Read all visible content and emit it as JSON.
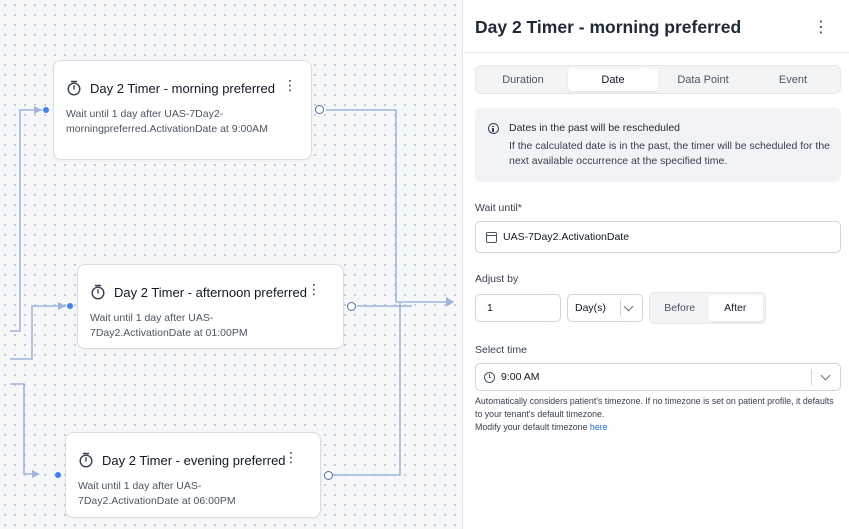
{
  "canvas": {
    "nodes": [
      {
        "title": "Day 2 Timer - morning preferred",
        "description": "Wait until 1 day after UAS-7Day2-morningpreferred.ActivationDate at 9:00AM"
      },
      {
        "title": "Day 2 Timer - afternoon preferred",
        "description": "Wait until 1 day after UAS-7Day2.ActivationDate at 01:00PM"
      },
      {
        "title": "Day 2 Timer - evening preferred",
        "description": "Wait until 1 day after UAS-7Day2.ActivationDate at 06:00PM"
      }
    ],
    "kebab": "⋮"
  },
  "panel": {
    "title": "Day 2 Timer - morning preferred",
    "kebab": "⋮",
    "tabs": [
      "Duration",
      "Date",
      "Data Point",
      "Event"
    ],
    "active_tab": "Date",
    "notice": {
      "title": "Dates in the past will be rescheduled",
      "body": "If the calculated date is in the past, the timer will be scheduled for the next available occurrence at the specified time."
    },
    "wait_until": {
      "label": "Wait until",
      "required_mark": "*",
      "value": "UAS-7Day2.ActivationDate"
    },
    "adjust_by": {
      "label": "Adjust by",
      "amount": "1",
      "unit": "Day(s)",
      "before_label": "Before",
      "after_label": "After",
      "selected": "After"
    },
    "select_time": {
      "label": "Select time",
      "value": "9:00 AM",
      "help": "Automatically considers patient's timezone. If no timezone is set on patient profile, it defaults to your tenant's default timezone.",
      "modify_text": "Modify your default timezone",
      "link_text": "here"
    }
  },
  "colors": {
    "wire": "#9db5df",
    "port_in": "#3b82f6",
    "link": "#1d6fd8"
  }
}
